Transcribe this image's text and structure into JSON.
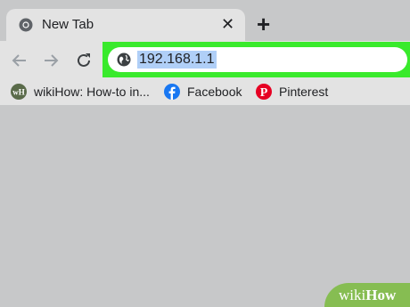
{
  "tab": {
    "title": "New Tab",
    "close_symbol": "✕"
  },
  "new_tab_symbol": "+",
  "omnibox": {
    "url": "192.168.1.1"
  },
  "bookmarks": [
    {
      "label": "wikiHow: How-to in...",
      "icon": "wikihow-favicon"
    },
    {
      "label": "Facebook",
      "icon": "facebook-icon"
    },
    {
      "label": "Pinterest",
      "icon": "pinterest-icon"
    }
  ],
  "watermark": {
    "part1": "wiki",
    "part2": "How"
  },
  "colors": {
    "highlight": "#39ea2c",
    "selection": "#b0cff7",
    "facebook": "#1877f2",
    "pinterest": "#e60023"
  }
}
